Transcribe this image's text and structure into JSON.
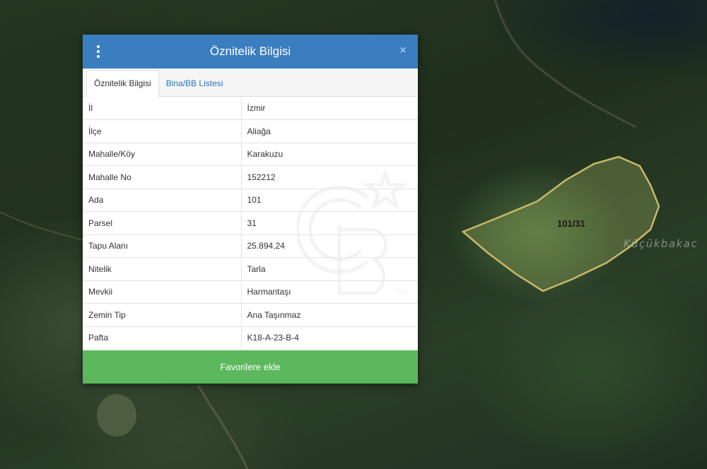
{
  "map": {
    "parcel_label": "101/31",
    "place_label": "Küçükbakac"
  },
  "dialog": {
    "title": "Öznitelik Bilgisi",
    "close_symbol": "×",
    "menu_icon": "vertical-dots-icon",
    "tabs": [
      {
        "label": "Öznitelik Bilgisi",
        "active": true
      },
      {
        "label": "Bina/BB Listesi",
        "active": false
      }
    ],
    "rows": [
      {
        "key": "İl",
        "value": "İzmir"
      },
      {
        "key": "İlçe",
        "value": "Aliağa"
      },
      {
        "key": "Mahalle/Köy",
        "value": "Karakuzu"
      },
      {
        "key": "Mahalle No",
        "value": "152212"
      },
      {
        "key": "Ada",
        "value": "101"
      },
      {
        "key": "Parsel",
        "value": "31"
      },
      {
        "key": "Tapu Alanı",
        "value": "25.894,24"
      },
      {
        "key": "Nitelik",
        "value": "Tarla"
      },
      {
        "key": "Mevkii",
        "value": "Harmantaşı"
      },
      {
        "key": "Zemin Tip",
        "value": "Ana Taşınmaz"
      },
      {
        "key": "Pafta",
        "value": "K18-A-23-B-4"
      }
    ],
    "favorite_button": "Favorilere ekle"
  },
  "watermark": {
    "text": "SM",
    "logo": "cb-star-logo-icon"
  },
  "colors": {
    "header": "#3a7ec0",
    "button": "#5cb85c",
    "tab_link": "#2a74b8",
    "parcel_outline": "#c9b86a"
  }
}
